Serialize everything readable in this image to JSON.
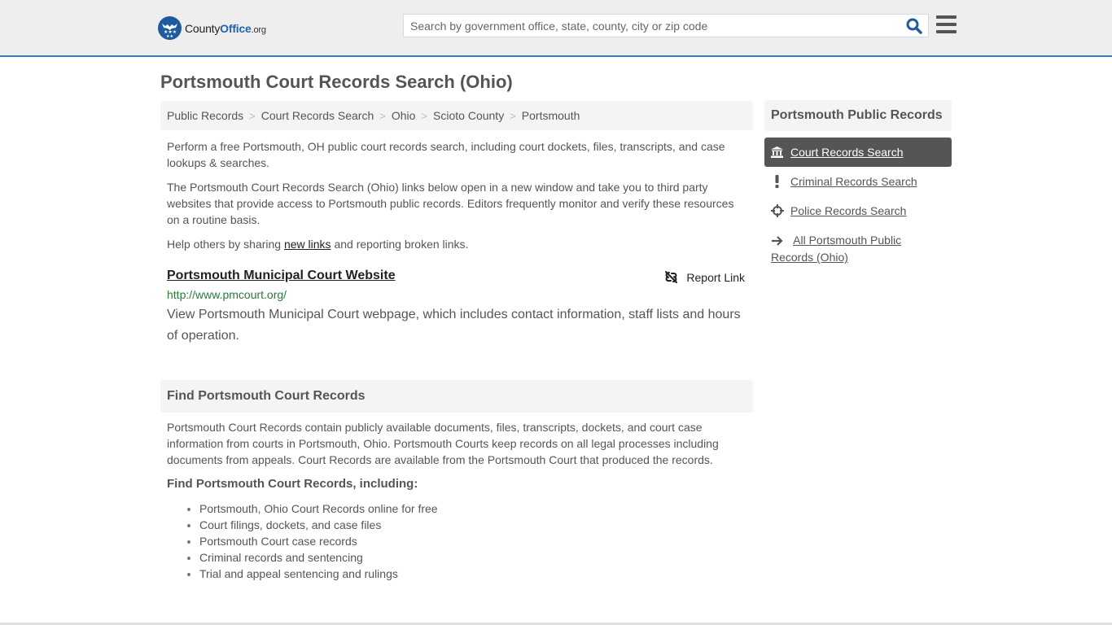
{
  "header": {
    "logo": {
      "county": "County",
      "office": "Office",
      "org": ".org",
      "icon": "eagle-stars-icon"
    },
    "search": {
      "placeholder": "Search by government office, state, county, city or zip code",
      "value": "",
      "icon": "search-icon"
    },
    "menu_icon": "hamburger-menu-icon"
  },
  "page": {
    "title": "Portsmouth Court Records Search (Ohio)"
  },
  "breadcrumb": [
    {
      "label": "Public Records"
    },
    {
      "label": "Court Records Search"
    },
    {
      "label": "Ohio"
    },
    {
      "label": "Scioto County"
    },
    {
      "label": "Portsmouth"
    }
  ],
  "intro": {
    "p1": "Perform a free Portsmouth, OH public court records search, including court dockets, files, transcripts, and case lookups & searches.",
    "p2": "The Portsmouth Court Records Search (Ohio) links below open in a new window and take you to third party websites that provide access to Portsmouth public records. Editors frequently monitor and verify these resources on a routine basis.",
    "p3_before": "Help others by sharing ",
    "p3_link": "new links",
    "p3_after": " and reporting broken links."
  },
  "results": [
    {
      "title": "Portsmouth Municipal Court Website",
      "url": "http://www.pmcourt.org/",
      "description": "View Portsmouth Municipal Court webpage, which includes contact information, staff lists and hours of operation.",
      "report_label": "Report Link",
      "report_icon": "broken-link-icon"
    }
  ],
  "find_section": {
    "heading": "Find Portsmouth Court Records",
    "body": "Portsmouth Court Records contain publicly available documents, files, transcripts, dockets, and court case information from courts in Portsmouth, Ohio. Portsmouth Courts keep records on all legal processes including documents from appeals. Court Records are available from the Portsmouth Court that produced the records.",
    "subheading": "Find Portsmouth Court Records, including:",
    "items": [
      "Portsmouth, Ohio Court Records online for free",
      "Court filings, dockets, and case files",
      "Portsmouth Court case records",
      "Criminal records and sentencing",
      "Trial and appeal sentencing and rulings"
    ]
  },
  "sidebar": {
    "heading": "Portsmouth Public Records",
    "items": [
      {
        "label": "Court Records Search",
        "icon": "courthouse-icon",
        "active": true
      },
      {
        "label": "Criminal Records Search",
        "icon": "exclamation-icon",
        "active": false
      },
      {
        "label": "Police Records Search",
        "icon": "crosshair-icon",
        "active": false
      },
      {
        "label": "All Portsmouth Public Records (Ohio)",
        "icon": "arrow-right-icon",
        "active": false
      }
    ]
  },
  "colors": {
    "brand_blue": "#1f5a9e",
    "header_border": "#3a79b0",
    "url_green": "#2a7a3a",
    "active_nav": "#555555"
  }
}
